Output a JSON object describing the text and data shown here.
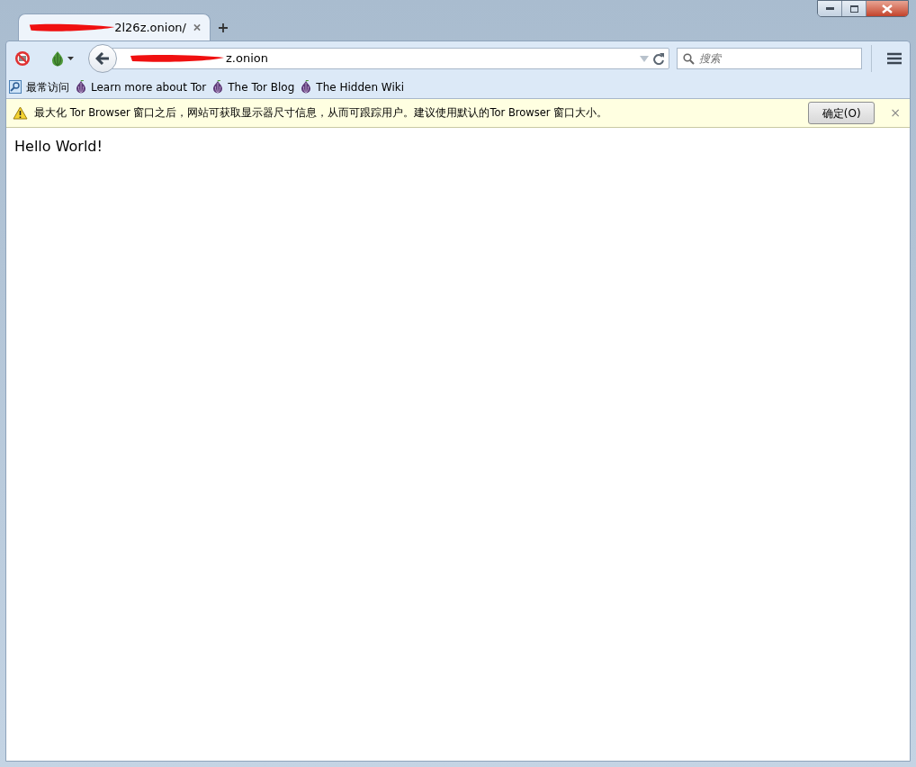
{
  "tabs": [
    {
      "title": "2l26z.onion/",
      "selected": true
    }
  ],
  "toolbar": {
    "url": "z.onion",
    "search_placeholder": "搜索"
  },
  "bookmarks": [
    {
      "label": "最常访问",
      "kind": "folder"
    },
    {
      "label": "Learn more about Tor",
      "kind": "onion"
    },
    {
      "label": "The Tor Blog",
      "kind": "onion"
    },
    {
      "label": "The Hidden Wiki",
      "kind": "onion"
    }
  ],
  "notification": {
    "message": "最大化 Tor Browser 窗口之后，网站可获取显示器尺寸信息，从而可跟踪用户。建议使用默认的Tor Browser 窗口大小。",
    "button": "确定(O)",
    "close": "×"
  },
  "content": {
    "text": "Hello World!"
  }
}
